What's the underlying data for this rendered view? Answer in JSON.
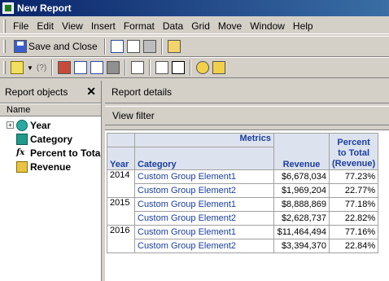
{
  "window": {
    "title": "New Report"
  },
  "menu": [
    "File",
    "Edit",
    "View",
    "Insert",
    "Format",
    "Data",
    "Grid",
    "Move",
    "Window",
    "Help"
  ],
  "toolbar": {
    "save_close_label": "Save and Close"
  },
  "left_panel": {
    "title": "Report objects",
    "close_glyph": "✕",
    "column_header": "Name",
    "objects": [
      {
        "label": "Year",
        "icon": "attribute-year-icon",
        "expander": "+"
      },
      {
        "label": "Category",
        "icon": "attribute-category-icon"
      },
      {
        "label": "Percent to Tota",
        "icon": "fx-metric-icon",
        "fx": "fx"
      },
      {
        "label": "Revenue",
        "icon": "metric-icon"
      }
    ]
  },
  "report": {
    "details_title": "Report details",
    "view_filter_label": "View filter",
    "grid": {
      "metrics_label": "Metrics",
      "year_header": "Year",
      "category_header": "Category",
      "revenue_header": "Revenue",
      "percent_header": "Percent to Total (Revenue)",
      "rows": [
        {
          "year": "2014",
          "category": "Custom Group Element1",
          "revenue": "$6,678,034",
          "percent": "77.23%"
        },
        {
          "year": "",
          "category": "Custom Group Element2",
          "revenue": "$1,969,204",
          "percent": "22.77%"
        },
        {
          "year": "2015",
          "category": "Custom Group Element1",
          "revenue": "$8,888,869",
          "percent": "77.18%"
        },
        {
          "year": "",
          "category": "Custom Group Element2",
          "revenue": "$2,628,737",
          "percent": "22.82%"
        },
        {
          "year": "2016",
          "category": "Custom Group Element1",
          "revenue": "$11,464,494",
          "percent": "77.16%"
        },
        {
          "year": "",
          "category": "Custom Group Element2",
          "revenue": "$3,394,370",
          "percent": "22.84%"
        }
      ]
    }
  }
}
